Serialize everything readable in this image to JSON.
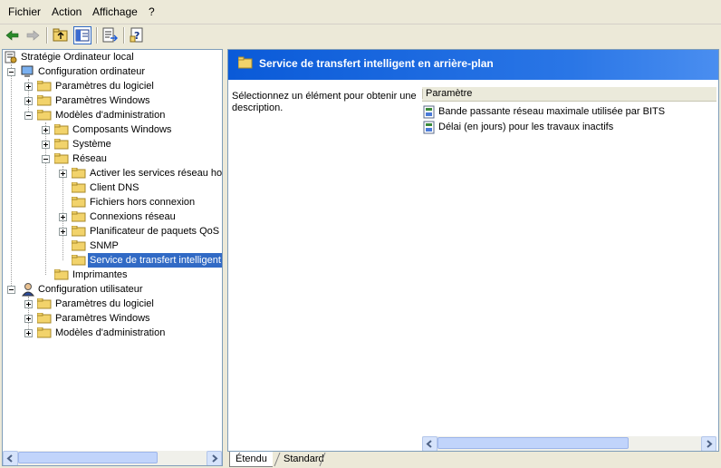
{
  "menu": {
    "items": [
      "Fichier",
      "Action",
      "Affichage",
      "?"
    ]
  },
  "toolbar": {
    "buttons": [
      "back-arrow-icon",
      "forward-arrow-icon",
      "up-folder-icon",
      "show-hide-tree-icon",
      "export-list-icon",
      "help-icon"
    ]
  },
  "tree": {
    "root": "Stratégie Ordinateur local",
    "computer_config": "Configuration ordinateur",
    "cc_software": "Paramètres du logiciel",
    "cc_windows": "Paramètres Windows",
    "cc_admin": "Modèles d'administration",
    "components": "Composants Windows",
    "system": "Système",
    "network": "Réseau",
    "net_offline_services": "Activer les services réseau hor",
    "net_dns": "Client DNS",
    "net_offline_files": "Fichiers hors connexion",
    "net_connections": "Connexions réseau",
    "net_qos": "Planificateur de paquets QoS",
    "net_snmp": "SNMP",
    "net_bits": "Service de transfert intelligent",
    "printers": "Imprimantes",
    "user_config": "Configuration utilisateur",
    "uc_software": "Paramètres du logiciel",
    "uc_windows": "Paramètres Windows",
    "uc_admin": "Modèles d'administration"
  },
  "details": {
    "title": "Service de transfert intelligent en arrière-plan",
    "description": "Sélectionnez un élément pour obtenir une description.",
    "column_header": "Paramètre",
    "settings": [
      "Bande passante réseau maximale utilisée par BITS",
      "Délai (en jours) pour les travaux inactifs"
    ]
  },
  "tabs": {
    "extended": "Étendu",
    "standard": "Standard"
  },
  "colors": {
    "header_blue": "#0a5ad8",
    "selection": "#316ac5",
    "folder": "#f2d36b"
  }
}
